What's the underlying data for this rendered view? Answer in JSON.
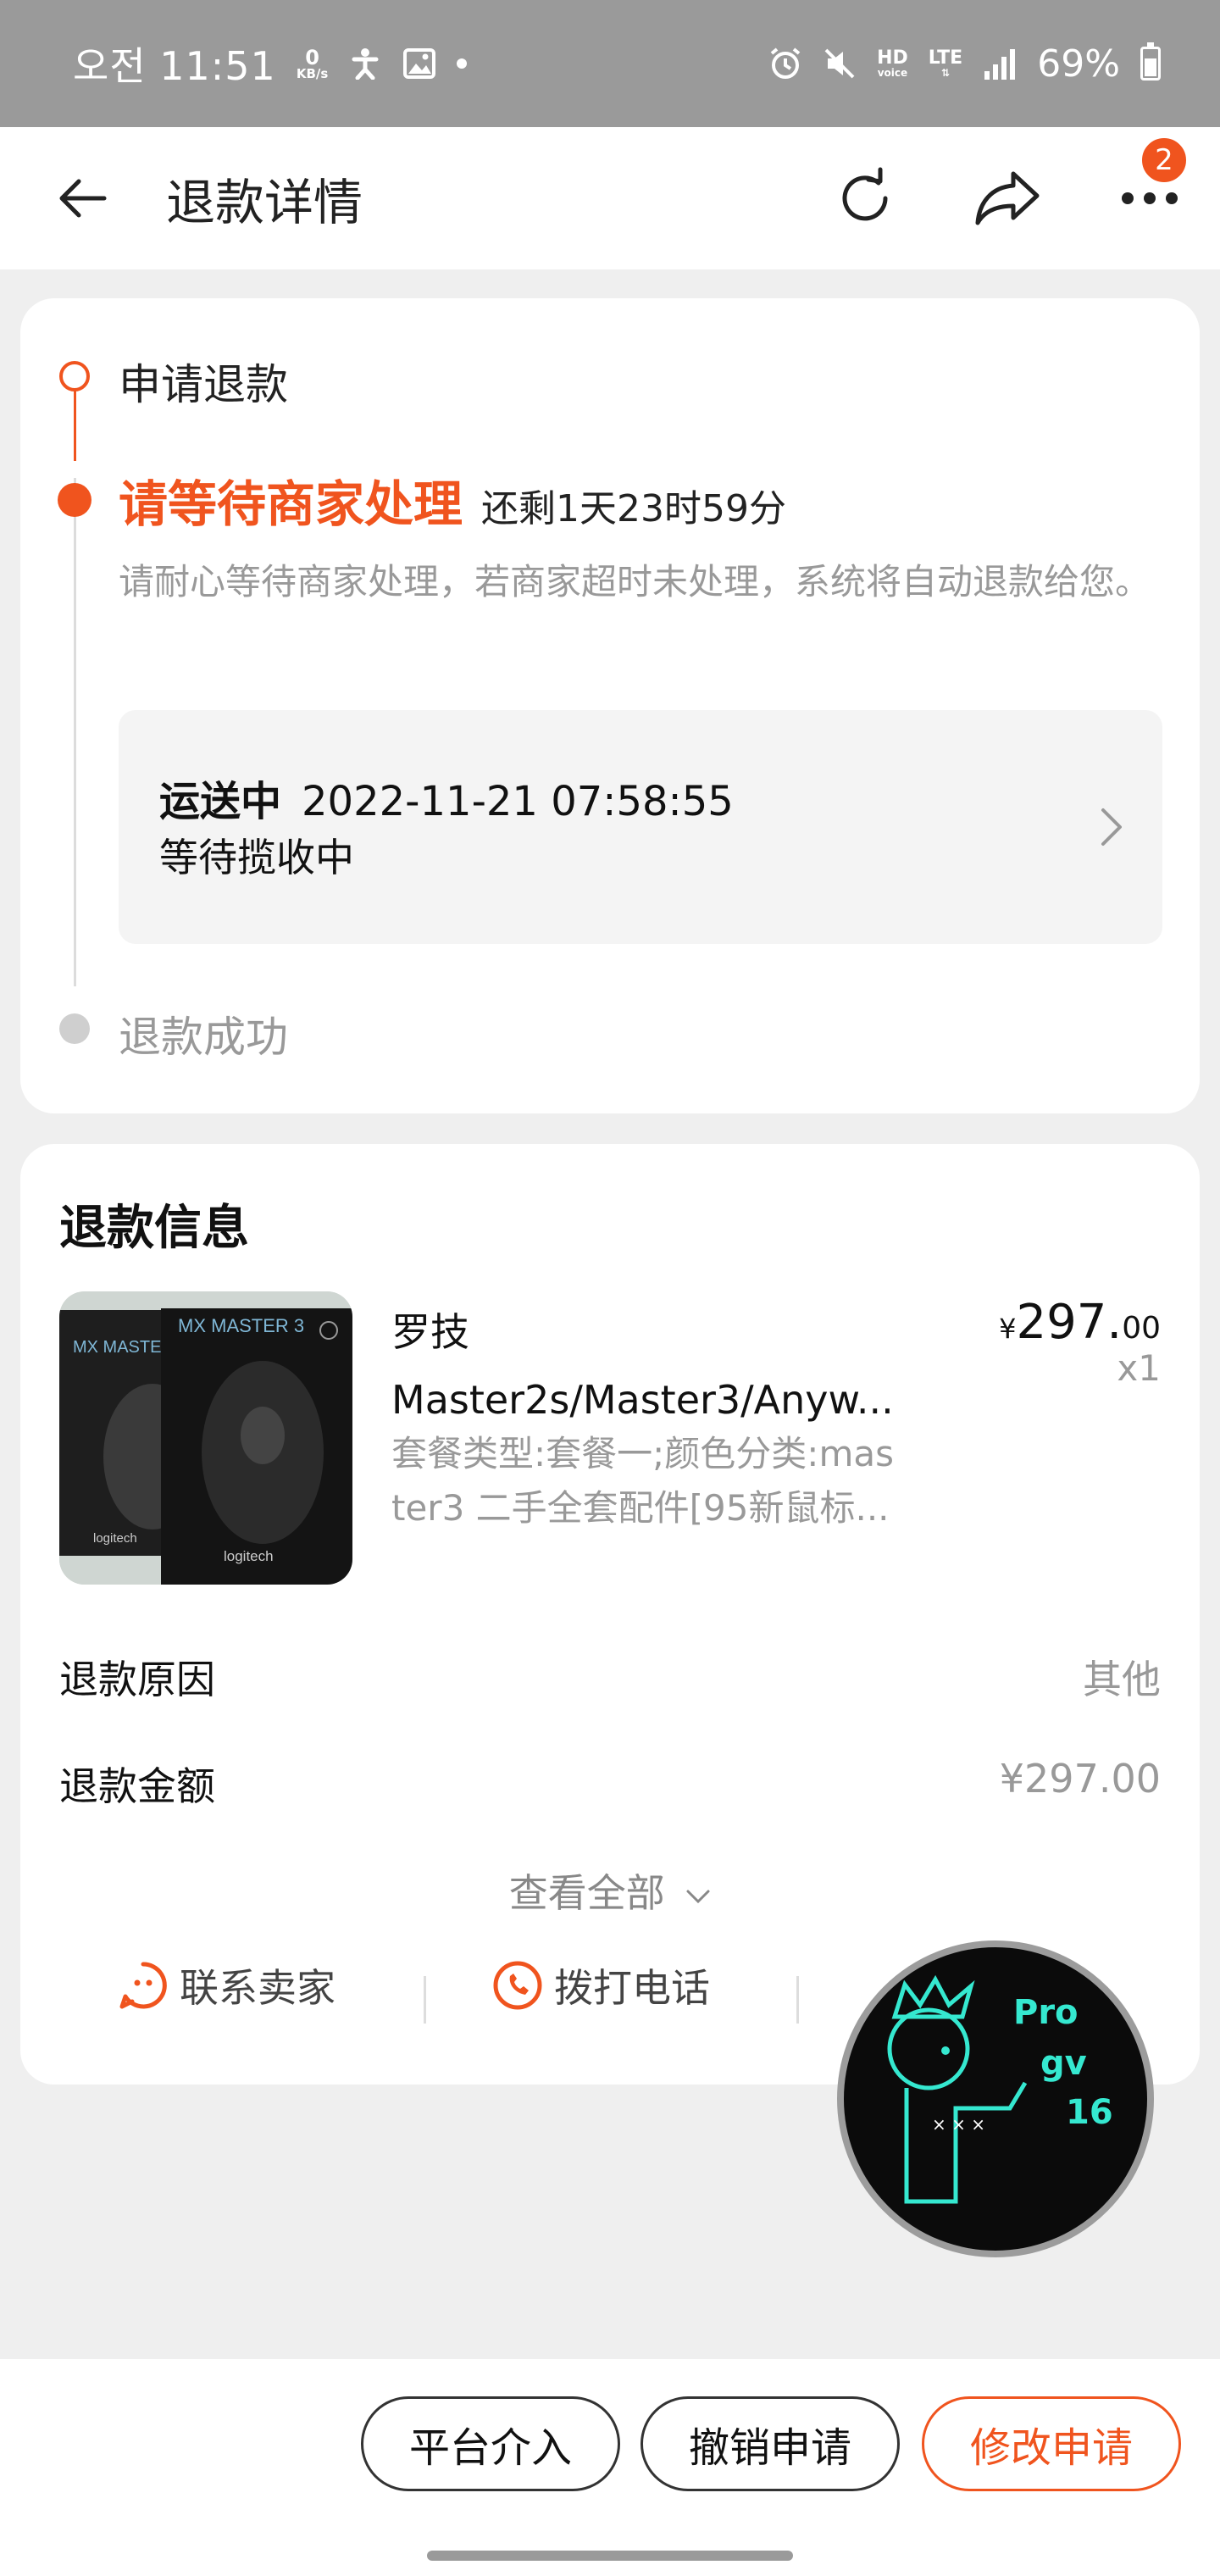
{
  "status_bar": {
    "time": "오전 11:51",
    "net_speed_value": "0",
    "net_speed_unit": "KB/s",
    "hd_label": "HD",
    "hd_sub": "voice",
    "lte_label": "LTE",
    "battery_pct": "69%"
  },
  "header": {
    "title": "退款详情",
    "more_badge": "2"
  },
  "timeline": {
    "step1": "申请退款",
    "step2_title": "请等待商家处理",
    "step2_countdown": "还剩1天23时59分",
    "step2_desc": "请耐心等待商家处理，若商家超时未处理，系统将自动退款给您。",
    "shipping_status": "运送中",
    "shipping_time": "2022-11-21 07:58:55",
    "shipping_detail": "等待揽收中",
    "step3": "退款成功"
  },
  "refund_info": {
    "title": "退款信息",
    "product": {
      "name_line1": "罗技",
      "name_line2": "Master2s/Master3/Anyw...",
      "spec_line1": "套餐类型:套餐一;颜色分类:mas",
      "spec_line2": "ter3 二手全套配件[95新鼠标...",
      "price_yen": "¥",
      "price_int": "297.",
      "price_dec": "00",
      "qty": "x1"
    },
    "rows": [
      {
        "label": "退款原因",
        "value": "其他"
      },
      {
        "label": "退款金额",
        "value": "¥297.00"
      }
    ],
    "view_all": "查看全部",
    "contact_seller": "联系卖家",
    "call_phone": "拨打电话"
  },
  "watermark": {
    "text1": "Pro",
    "text2": "gv",
    "text3": "16"
  },
  "bottom_buttons": {
    "platform": "平台介入",
    "cancel": "撤销申请",
    "modify": "修改申请"
  },
  "colors": {
    "accent": "#f0541e",
    "gray_text": "#999999",
    "background": "#efefef"
  }
}
